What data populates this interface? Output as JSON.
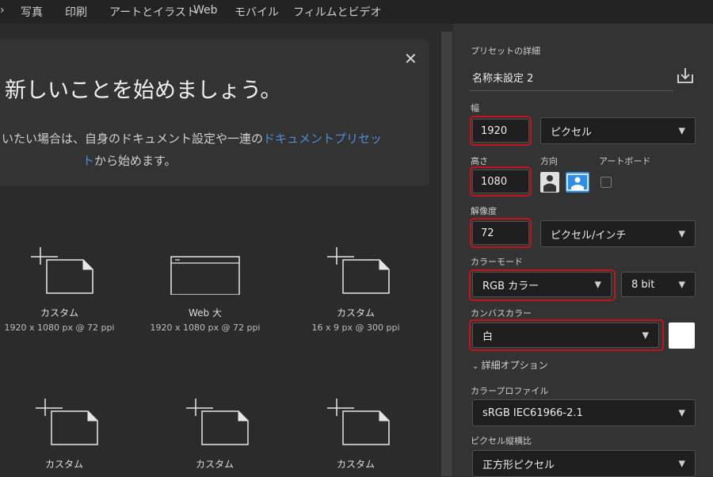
{
  "menu": {
    "lead": "›",
    "tabs": [
      "写真",
      "印刷",
      "アートとイラスト",
      "Web",
      "モバイル",
      "フィルムとビデオ"
    ]
  },
  "welcome": {
    "close": "✕",
    "title": "新しいことを始めましょう。",
    "desc_line1_pre": "いたい場合は、自身のドキュメント設定や一連の",
    "desc_line1_link": "ドキュメントプリセッ",
    "desc_line2_link": "ト",
    "desc_line2_post": "から始めます。"
  },
  "presets": [
    {
      "name": "カスタム",
      "size": "1920 x 1080 px @ 72 ppi",
      "icon": "custom-document-icon"
    },
    {
      "name": "Web 大",
      "size": "1920 x 1080 px @ 72 ppi",
      "icon": "web-document-icon"
    },
    {
      "name": "カスタム",
      "size": "16 x 9 px @ 300 ppi",
      "icon": "custom-document-icon"
    },
    {
      "name": "カスタム",
      "size": "",
      "icon": "custom-document-icon"
    },
    {
      "name": "カスタム",
      "size": "",
      "icon": "custom-document-icon"
    },
    {
      "name": "カスタム",
      "size": "",
      "icon": "custom-document-icon"
    }
  ],
  "details": {
    "header": "プリセットの詳細",
    "doc_name": "名称未設定 2",
    "save_icon": "save-preset-icon",
    "width_label": "幅",
    "width_value": "1920",
    "width_unit": "ピクセル",
    "height_label": "高さ",
    "height_value": "1080",
    "orientation_label": "方向",
    "artboard_label": "アートボード",
    "resolution_label": "解像度",
    "resolution_value": "72",
    "resolution_unit": "ピクセル/インチ",
    "color_mode_label": "カラーモード",
    "color_mode_value": "RGB カラー",
    "bit_depth": "8 bit",
    "canvas_color_label": "カンバスカラー",
    "canvas_color_value": "白",
    "canvas_swatch": "#ffffff",
    "advanced_label": "詳細オプション",
    "color_profile_label": "カラープロファイル",
    "color_profile_value": "sRGB IEC61966-2.1",
    "pixel_aspect_label": "ピクセル縦横比",
    "pixel_aspect_value": "正方形ピクセル"
  },
  "colors": {
    "highlight_box": "#c0141a",
    "link": "#4c8ed6",
    "selected_orientation": "#2f8de4"
  }
}
